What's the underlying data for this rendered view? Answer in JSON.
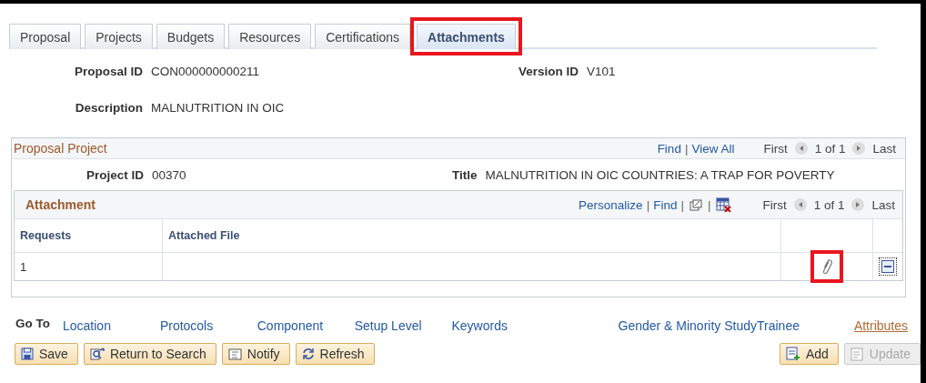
{
  "tabs": [
    {
      "label": "Proposal",
      "selected": false,
      "highlighted": false
    },
    {
      "label": "Projects",
      "selected": false,
      "highlighted": false
    },
    {
      "label": "Budgets",
      "selected": false,
      "highlighted": false
    },
    {
      "label": "Resources",
      "selected": false,
      "highlighted": false
    },
    {
      "label": "Certifications",
      "selected": false,
      "highlighted": false
    },
    {
      "label": "Attachments",
      "selected": true,
      "highlighted": true
    }
  ],
  "header": {
    "proposal_id_label": "Proposal ID",
    "proposal_id": "CON000000000211",
    "version_id_label": "Version ID",
    "version_id": "V101",
    "description_label": "Description",
    "description": "MALNUTRITION IN OIC"
  },
  "project_panel": {
    "title": "Proposal Project",
    "find": "Find",
    "separator": "|",
    "view_all": "View All",
    "first": "First",
    "count": "1 of 1",
    "last": "Last",
    "project_id_label": "Project ID",
    "project_id": "00370",
    "title_label": "Title",
    "project_title": "MALNUTRITION IN OIC COUNTRIES: A TRAP FOR POVERTY"
  },
  "attachment_grid": {
    "title": "Attachment",
    "personalize": "Personalize",
    "separator": "|",
    "find": "Find",
    "first": "First",
    "count": "1 of 1",
    "last": "Last",
    "columns": [
      "Requests",
      "Attached File"
    ],
    "rows": [
      {
        "requests": "1",
        "attached_file": "",
        "attach_highlighted": true
      }
    ]
  },
  "goto": {
    "label": "Go To",
    "links": [
      {
        "label": "Location",
        "visited": false
      },
      {
        "label": "Protocols",
        "visited": false
      },
      {
        "label": "Component",
        "visited": false
      },
      {
        "label": "Setup Level",
        "visited": false
      },
      {
        "label": "Keywords",
        "visited": false
      },
      {
        "label": "Gender & Minority Study",
        "visited": false
      },
      {
        "label": "Trainee",
        "visited": false
      },
      {
        "label": "Attributes",
        "visited": true
      }
    ]
  },
  "buttons_left": [
    {
      "label": "Save",
      "kind": "save",
      "disabled": false
    },
    {
      "label": "Return to Search",
      "kind": "search",
      "disabled": false
    },
    {
      "label": "Notify",
      "kind": "notify",
      "disabled": false
    },
    {
      "label": "Refresh",
      "kind": "refresh",
      "disabled": false
    }
  ],
  "buttons_right": [
    {
      "label": "Add",
      "kind": "add",
      "disabled": false
    },
    {
      "label": "Update",
      "kind": "update",
      "disabled": true
    }
  ]
}
